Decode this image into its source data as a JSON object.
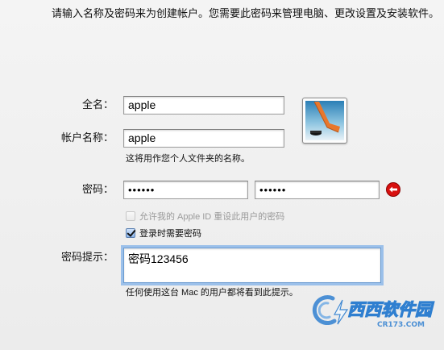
{
  "intro": "请输入名称及密码来为创建帐户。您需要此密码来管理电脑、更改设置及安装软件。",
  "full_name": {
    "label": "全名：",
    "value": "apple"
  },
  "account_name": {
    "label": "帐户名称：",
    "value": "apple",
    "note": "这将用作您个人文件夹的名称。"
  },
  "password": {
    "label": "密码：",
    "value": "••••••",
    "verify_value": "••••••"
  },
  "apple_id_reset": {
    "label": "允许我的 Apple ID 重设此用户的密码",
    "checked": false,
    "enabled": false
  },
  "require_password": {
    "label": "登录时需要密码",
    "checked": true
  },
  "password_hint": {
    "label": "密码提示：",
    "value": "密码123456",
    "note": "任何使用这台 Mac 的用户都将看到此提示。"
  },
  "icons": {
    "avatar": "hockey-stick-picture",
    "error": "red-circle-arrow-icon",
    "watermark": "cr173-site-logo"
  },
  "watermark": {
    "brand": "西西软件园",
    "url": "CR173.COM"
  },
  "colors": {
    "focus_ring": "#9bc0ea",
    "error_red": "#d8100f",
    "watermark_blue": "#2f7fd0"
  }
}
